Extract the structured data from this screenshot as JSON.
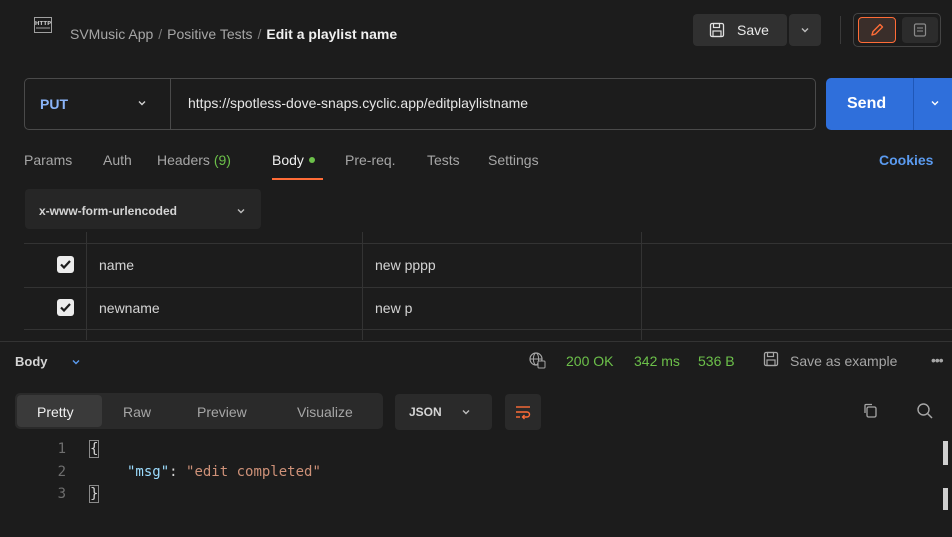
{
  "header": {
    "icon": "http-icon",
    "breadcrumb": [
      "SVMusic App",
      "Positive Tests"
    ],
    "current": "Edit a playlist name",
    "save_label": "Save"
  },
  "request": {
    "method": "PUT",
    "url": "https://spotless-dove-snaps.cyclic.app/editplaylistname",
    "send_label": "Send"
  },
  "request_tabs": {
    "params": "Params",
    "auth": "Auth",
    "headers": "Headers",
    "headers_count": "(9)",
    "body": "Body",
    "prereq": "Pre-req.",
    "tests": "Tests",
    "settings": "Settings",
    "active": "Body"
  },
  "cookies_label": "Cookies",
  "body_type": "x-www-form-urlencoded",
  "form_rows": [
    {
      "key": "name",
      "value": "new pppp",
      "checked": true
    },
    {
      "key": "newname",
      "value": "new p",
      "checked": true
    }
  ],
  "response": {
    "label": "Body",
    "status": "200 OK",
    "time": "342 ms",
    "size": "536 B",
    "save_example": "Save as example",
    "more": "•••",
    "tabs": {
      "pretty": "Pretty",
      "raw": "Raw",
      "preview": "Preview",
      "visualize": "Visualize",
      "active": "Pretty"
    },
    "format": "JSON",
    "code": {
      "line_numbers": [
        "1",
        "2",
        "3"
      ],
      "open_brace": "{",
      "close_brace": "}",
      "key": "\"msg\"",
      "colon": ": ",
      "value": "\"edit completed\""
    }
  },
  "colors": {
    "accent_orange": "#ff6c37",
    "send_blue": "#2f6fdb",
    "success_green": "#6cc04a",
    "link_blue": "#5b9bf0"
  }
}
